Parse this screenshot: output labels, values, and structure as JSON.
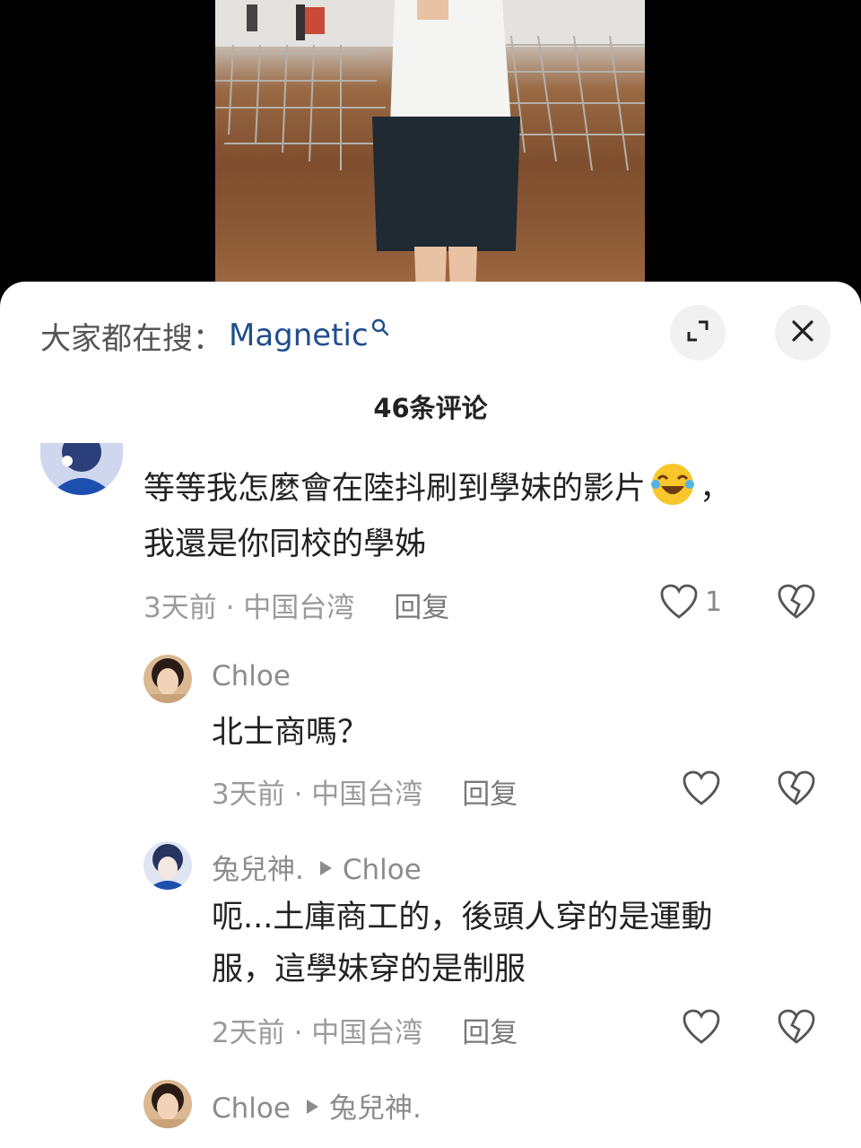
{
  "search": {
    "prefix": "大家都在搜：",
    "term": "Magnetic"
  },
  "comments_title": "46条评论",
  "comments": [
    {
      "line1": "等等我怎麼會在陸抖刷到學妹的影片",
      "line1_end": "，",
      "line2": "我還是你同校的學姊",
      "time": "3天前 · 中国台湾",
      "reply": "回复",
      "likes": "1"
    }
  ],
  "replies": [
    {
      "name": "Chloe",
      "text": "北士商嗎？",
      "time": "3天前 · 中国台湾",
      "reply": "回复"
    },
    {
      "name": "兔兒神.",
      "reply_to": "Chloe",
      "line1": "呃...土庫商工的，後頭人穿的是運動",
      "line2": "服，這學妹穿的是制服",
      "time": "2天前 · 中国台湾",
      "reply": "回复"
    },
    {
      "name": "Chloe",
      "reply_to": "兔兒神."
    }
  ],
  "icons": {
    "expand": "expand-icon",
    "close": "close-icon",
    "search": "search-icon",
    "like": "heart-icon",
    "dislike": "broken-heart-icon",
    "emoji": "laughing-crying-emoji"
  },
  "colors": {
    "search_term": "#1f4e8c",
    "meta": "#9a9a9a"
  }
}
